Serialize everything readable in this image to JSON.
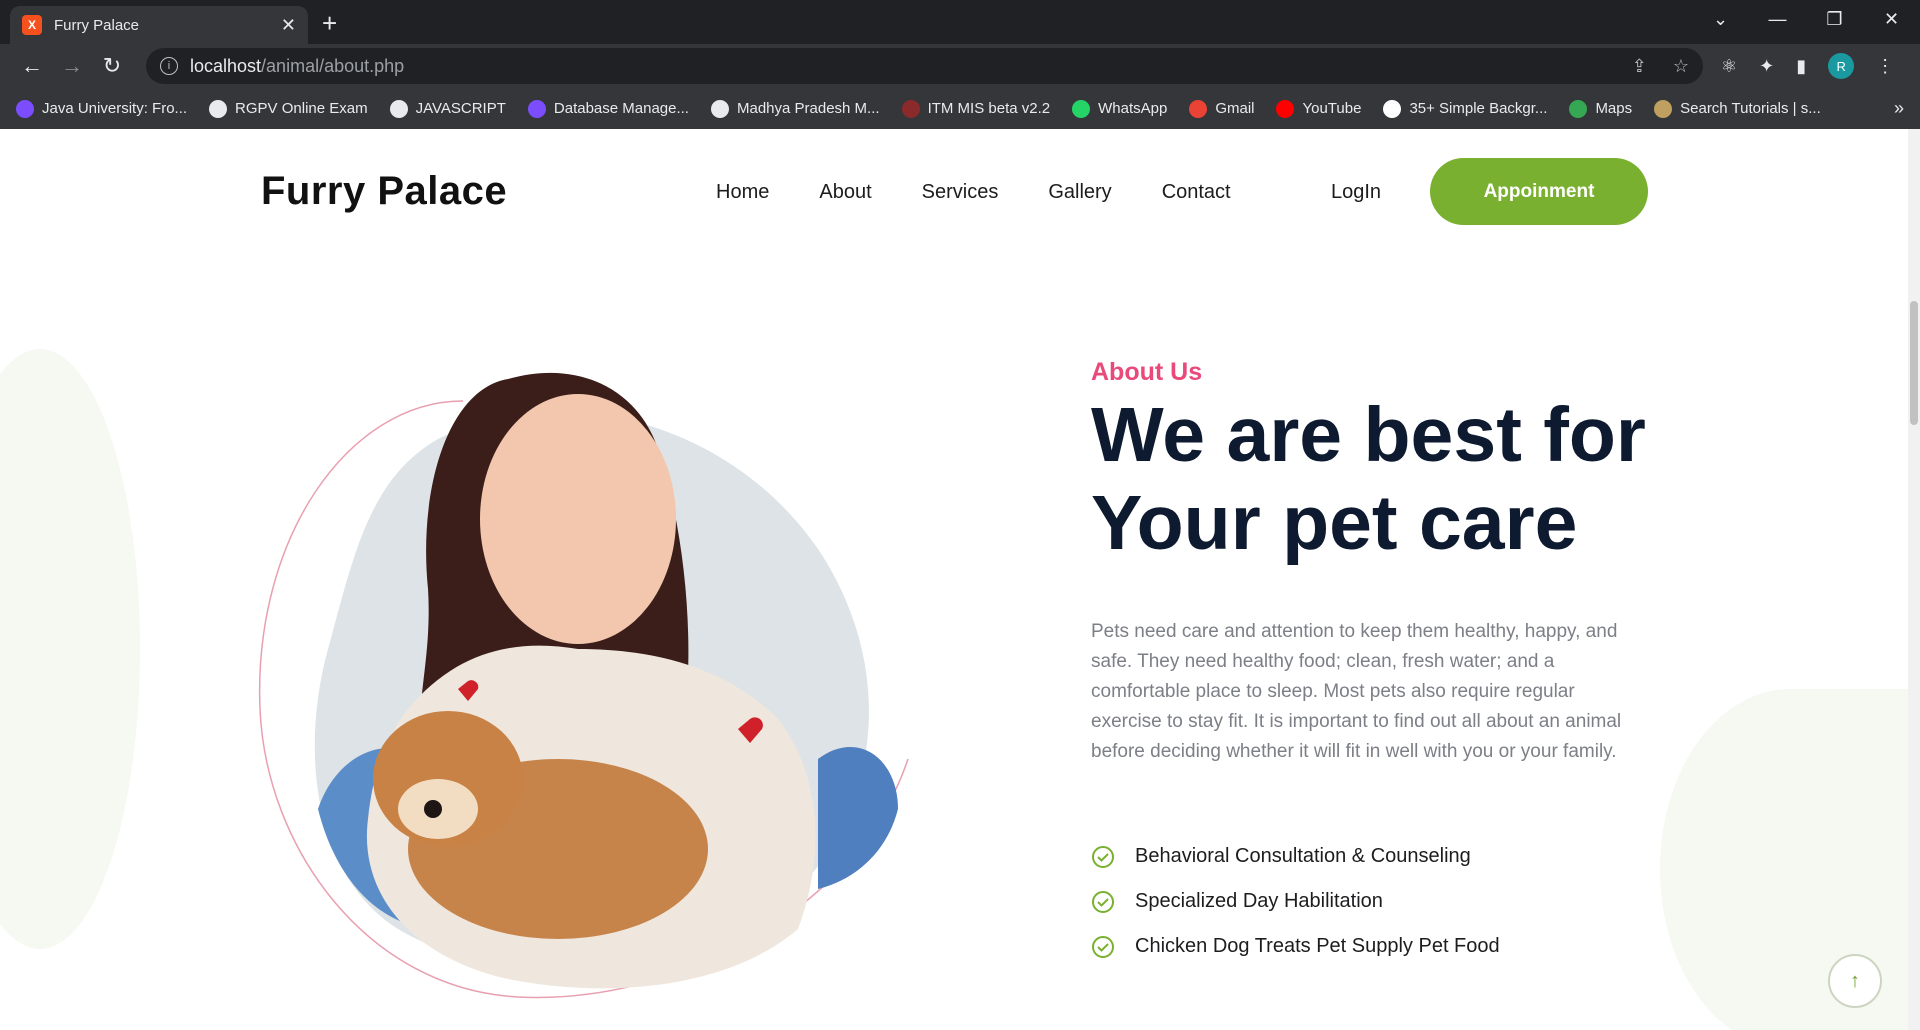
{
  "browser": {
    "tab_title": "Furry Palace",
    "tab_favicon_text": "X",
    "url_host": "localhost",
    "url_path": "/animal/about.php",
    "avatar_letter": "R",
    "bookmarks": [
      {
        "label": "Java University: Fro...",
        "color": "#7c4dff"
      },
      {
        "label": "RGPV Online Exam",
        "color": "#e8eaed"
      },
      {
        "label": "JAVASCRIPT",
        "color": "#e8eaed"
      },
      {
        "label": "Database Manage...",
        "color": "#7c4dff"
      },
      {
        "label": "Madhya Pradesh M...",
        "color": "#e8eaed"
      },
      {
        "label": "ITM MIS beta v2.2",
        "color": "#8b2a2a"
      },
      {
        "label": "WhatsApp",
        "color": "#25d366"
      },
      {
        "label": "Gmail",
        "color": "#ea4335"
      },
      {
        "label": "YouTube",
        "color": "#ff0000"
      },
      {
        "label": "35+ Simple Backgr...",
        "color": "#ffffff"
      },
      {
        "label": "Maps",
        "color": "#34a853"
      },
      {
        "label": "Search Tutorials | s...",
        "color": "#c0a060"
      }
    ]
  },
  "site": {
    "logo": "Furry Palace",
    "nav": [
      "Home",
      "About",
      "Services",
      "Gallery",
      "Contact"
    ],
    "login": "LogIn",
    "appointment": "Appoinment"
  },
  "about": {
    "label": "About Us",
    "headline_line1": "We are best for",
    "headline_line2": "Your pet care",
    "description": "Pets need care and attention to keep them healthy, happy, and safe. They need healthy food; clean, fresh water; and a comfortable place to sleep. Most pets also require regular exercise to stay fit. It is important to find out all about an animal before deciding whether it will fit in well with you or your family.",
    "features": [
      "Behavioral Consultation & Counseling",
      "Specialized Day Habilitation",
      "Chicken Dog Treats Pet Supply Pet Food"
    ]
  },
  "colors": {
    "accent_green": "#7ab02f",
    "accent_pink": "#e94a7a",
    "headline": "#0e1a2f"
  }
}
